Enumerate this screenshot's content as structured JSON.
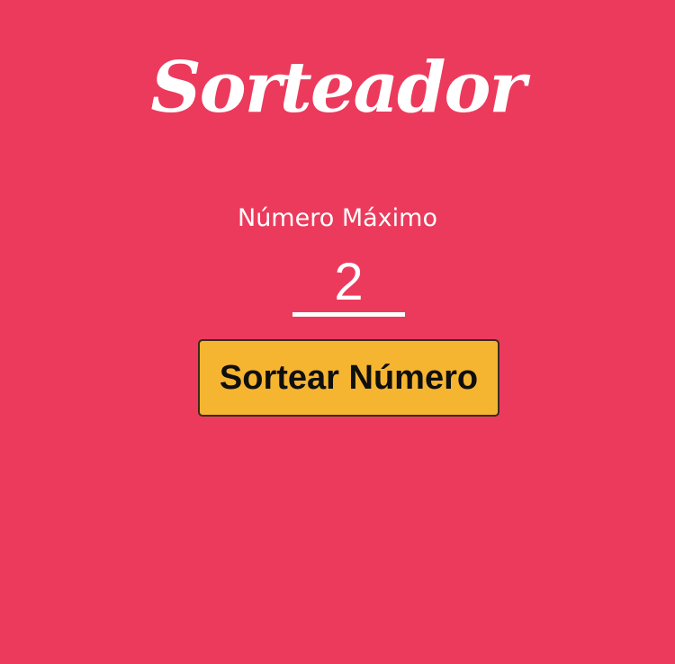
{
  "header": {
    "title": "Sorteador"
  },
  "form": {
    "max_label": "Número Máximo",
    "max_value": "2",
    "button_label": "Sortear Número"
  },
  "colors": {
    "background": "#ec3a5c",
    "button": "#f6b531",
    "text": "#ffffff"
  }
}
